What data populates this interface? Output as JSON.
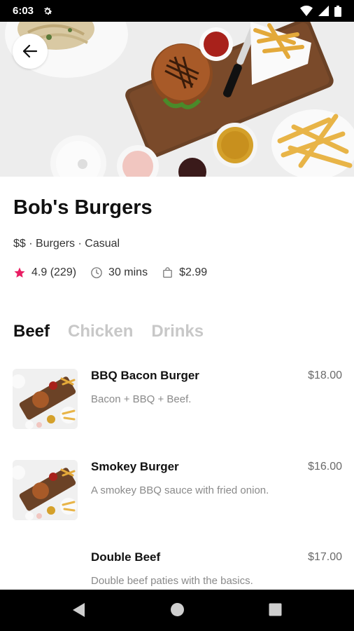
{
  "status_bar": {
    "time": "6:03"
  },
  "restaurant": {
    "name": "Bob's Burgers",
    "meta": "$$ · Burgers · Casual",
    "rating": "4.9 (229)",
    "delivery_time": "30 mins",
    "delivery_fee": "$2.99"
  },
  "tabs": [
    {
      "label": "Beef",
      "active": true
    },
    {
      "label": "Chicken",
      "active": false
    },
    {
      "label": "Drinks",
      "active": false
    }
  ],
  "menu_items": [
    {
      "name": "BBQ Bacon Burger",
      "description": "Bacon + BBQ + Beef.",
      "price": "$18.00"
    },
    {
      "name": "Smokey Burger",
      "description": "A smokey BBQ sauce with fried onion.",
      "price": "$16.00"
    },
    {
      "name": "Double Beef",
      "description": "Double beef paties with the basics.",
      "price": "$17.00"
    }
  ],
  "colors": {
    "star": "#e91e63",
    "status_bar": "#000000",
    "nav_bar": "#000000"
  },
  "icons": [
    "settings-gear-icon",
    "wifi-icon",
    "signal-icon",
    "battery-icon",
    "back-arrow-icon",
    "star-icon",
    "clock-icon",
    "bag-icon",
    "nav-back-icon",
    "nav-home-icon",
    "nav-recents-icon"
  ]
}
